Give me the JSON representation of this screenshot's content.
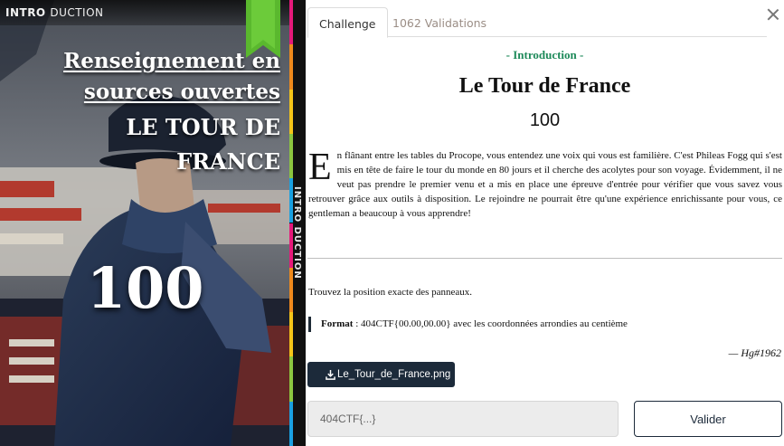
{
  "art": {
    "header_bold": "INTRO",
    "header_thin": "DUCTION",
    "spine_text": "INTRO DUCTION",
    "title_line1": "Renseignement en",
    "title_line2": "sources ouvertes",
    "title_line3": "LE TOUR DE",
    "title_line4": "FRANCE",
    "points": "100",
    "spine_colors": [
      "#e6197a",
      "#f08a1c",
      "#f5c518",
      "#8cc63f",
      "#1aa0e0",
      "#e6197a",
      "#f08a1c",
      "#f5c518",
      "#8cc63f",
      "#1aa0e0"
    ]
  },
  "tabs": {
    "challenge": "Challenge",
    "validations": "1062 Validations"
  },
  "challenge": {
    "category": "- Introduction -",
    "title": "Le Tour de France",
    "points": "100",
    "dropcap": "E",
    "story": "n flânant entre les tables du Procope, vous entendez une voix qui vous est familière. C'est Phileas Fogg qui s'est mis en tête de faire le tour du monde en 80 jours et il cherche des acolytes pour son voyage. Évidemment, il ne veut pas prendre le premier venu et a mis en place une épreuve d'entrée pour vérifier que vous savez vous retrouver grâce aux outils à disposition. Le rejoindre ne pourrait être qu'une expérience enrichissante pour vous, ce gentleman a beaucoup à vous apprendre!",
    "task": "Trouvez la position exacte des panneaux.",
    "format_label": "Format",
    "format_text": " : 404CTF{00.00,00.00} avec les coordonnées arrondies au centième",
    "author": "— Hg#1962"
  },
  "download": {
    "label": "Le_Tour_de_France.png"
  },
  "flag": {
    "placeholder": "404CTF{...}",
    "submit_label": "Valider"
  }
}
